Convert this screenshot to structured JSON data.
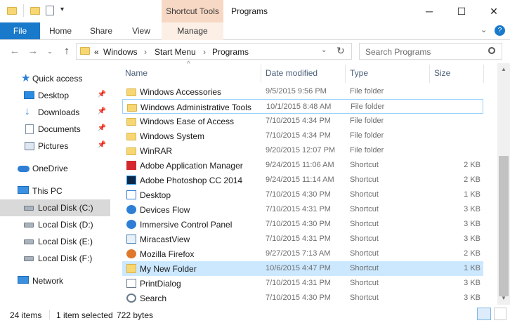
{
  "window": {
    "contextual_tab_group": "Shortcut Tools",
    "title": "Programs",
    "controls": {
      "minimize": "─",
      "maximize": "☐",
      "close": "✕"
    }
  },
  "ribbon": {
    "tabs": [
      "File",
      "Home",
      "Share",
      "View",
      "Manage"
    ],
    "expand_icon": "⌄",
    "help_icon": "?"
  },
  "address": {
    "prefix": "«",
    "crumbs": [
      "Windows",
      "Start Menu",
      "Programs"
    ],
    "separator": "›",
    "search_placeholder": "Search Programs"
  },
  "nav": {
    "quick_access": "Quick access",
    "quick_items": [
      {
        "label": "Desktop",
        "icon": "desktop-icon"
      },
      {
        "label": "Downloads",
        "icon": "downloads-icon"
      },
      {
        "label": "Documents",
        "icon": "documents-icon"
      },
      {
        "label": "Pictures",
        "icon": "pictures-icon"
      }
    ],
    "onedrive": "OneDrive",
    "this_pc": "This PC",
    "drives": [
      "Local Disk (C:)",
      "Local Disk (D:)",
      "Local Disk (E:)",
      "Local Disk (F:)"
    ],
    "network": "Network",
    "pin_glyph": "📌"
  },
  "columns": {
    "name": "Name",
    "date": "Date modified",
    "type": "Type",
    "size": "Size"
  },
  "files": [
    {
      "name": "Windows Accessories",
      "date": "9/5/2015 9:56 PM",
      "type": "File folder",
      "size": "",
      "icon": "folder"
    },
    {
      "name": "Windows Administrative Tools",
      "date": "10/1/2015 8:48 AM",
      "type": "File folder",
      "size": "",
      "icon": "folder"
    },
    {
      "name": "Windows Ease of Access",
      "date": "7/10/2015 4:34 PM",
      "type": "File folder",
      "size": "",
      "icon": "folder"
    },
    {
      "name": "Windows System",
      "date": "7/10/2015 4:34 PM",
      "type": "File folder",
      "size": "",
      "icon": "folder"
    },
    {
      "name": "WinRAR",
      "date": "9/20/2015 12:07 PM",
      "type": "File folder",
      "size": "",
      "icon": "folder"
    },
    {
      "name": "Adobe Application Manager",
      "date": "9/24/2015 11:06 AM",
      "type": "Shortcut",
      "size": "2 KB",
      "icon": "adobe"
    },
    {
      "name": "Adobe Photoshop CC 2014",
      "date": "9/24/2015 11:14 AM",
      "type": "Shortcut",
      "size": "2 KB",
      "icon": "ps"
    },
    {
      "name": "Desktop",
      "date": "7/10/2015 4:30 PM",
      "type": "Shortcut",
      "size": "1 KB",
      "icon": "desktop"
    },
    {
      "name": "Devices Flow",
      "date": "7/10/2015 4:31 PM",
      "type": "Shortcut",
      "size": "3 KB",
      "icon": "gear"
    },
    {
      "name": "Immersive Control Panel",
      "date": "7/10/2015 4:30 PM",
      "type": "Shortcut",
      "size": "3 KB",
      "icon": "gear"
    },
    {
      "name": "MiracastView",
      "date": "7/10/2015 4:31 PM",
      "type": "Shortcut",
      "size": "3 KB",
      "icon": "mira"
    },
    {
      "name": "Mozilla Firefox",
      "date": "9/27/2015 7:13 AM",
      "type": "Shortcut",
      "size": "2 KB",
      "icon": "ff"
    },
    {
      "name": "My New Folder",
      "date": "10/6/2015 4:47 PM",
      "type": "Shortcut",
      "size": "1 KB",
      "icon": "newfolder"
    },
    {
      "name": "PrintDialog",
      "date": "7/10/2015 4:31 PM",
      "type": "Shortcut",
      "size": "3 KB",
      "icon": "print"
    },
    {
      "name": "Search",
      "date": "7/10/2015 4:30 PM",
      "type": "Shortcut",
      "size": "3 KB",
      "icon": "search"
    }
  ],
  "status": {
    "count": "24 items",
    "selected": "1 item selected",
    "size": "722 bytes"
  },
  "colors": {
    "accent": "#1979ca",
    "selection": "#cce8ff",
    "contextual": "#f7d8c4"
  }
}
